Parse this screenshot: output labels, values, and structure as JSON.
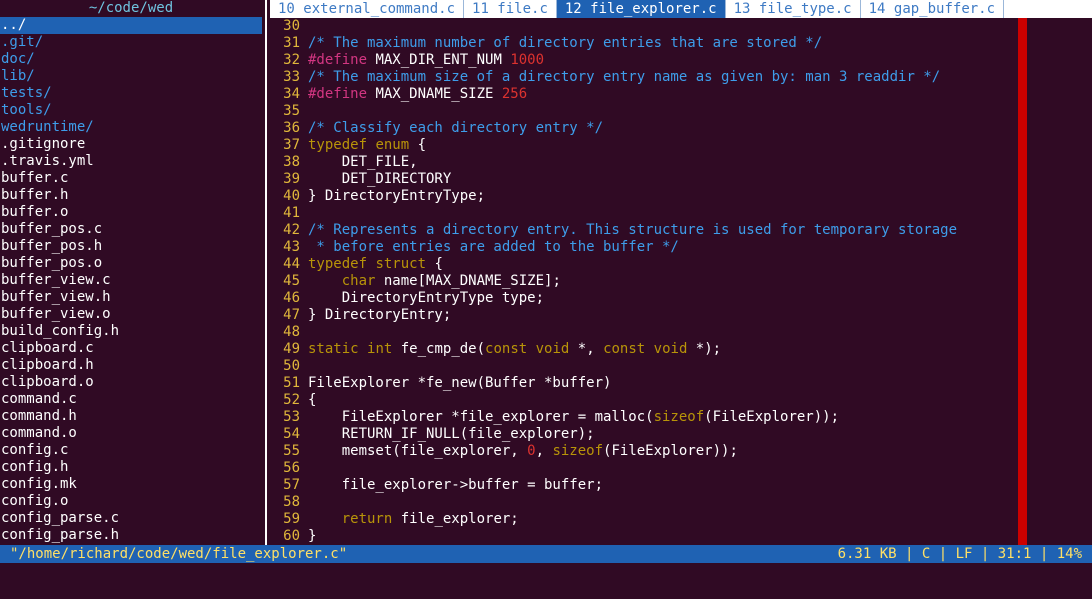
{
  "sidebar": {
    "title": "~/code/wed",
    "items": [
      {
        "label": "../",
        "kind": "dir",
        "selected": true
      },
      {
        "label": ".git/",
        "kind": "dir"
      },
      {
        "label": "doc/",
        "kind": "dir"
      },
      {
        "label": "lib/",
        "kind": "dir"
      },
      {
        "label": "tests/",
        "kind": "dir"
      },
      {
        "label": "tools/",
        "kind": "dir"
      },
      {
        "label": "wedruntime/",
        "kind": "dir"
      },
      {
        "label": ".gitignore",
        "kind": "file"
      },
      {
        "label": ".travis.yml",
        "kind": "file"
      },
      {
        "label": "buffer.c",
        "kind": "file"
      },
      {
        "label": "buffer.h",
        "kind": "file"
      },
      {
        "label": "buffer.o",
        "kind": "file"
      },
      {
        "label": "buffer_pos.c",
        "kind": "file"
      },
      {
        "label": "buffer_pos.h",
        "kind": "file"
      },
      {
        "label": "buffer_pos.o",
        "kind": "file"
      },
      {
        "label": "buffer_view.c",
        "kind": "file"
      },
      {
        "label": "buffer_view.h",
        "kind": "file"
      },
      {
        "label": "buffer_view.o",
        "kind": "file"
      },
      {
        "label": "build_config.h",
        "kind": "file"
      },
      {
        "label": "clipboard.c",
        "kind": "file"
      },
      {
        "label": "clipboard.h",
        "kind": "file"
      },
      {
        "label": "clipboard.o",
        "kind": "file"
      },
      {
        "label": "command.c",
        "kind": "file"
      },
      {
        "label": "command.h",
        "kind": "file"
      },
      {
        "label": "command.o",
        "kind": "file"
      },
      {
        "label": "config.c",
        "kind": "file"
      },
      {
        "label": "config.h",
        "kind": "file"
      },
      {
        "label": "config.mk",
        "kind": "file"
      },
      {
        "label": "config.o",
        "kind": "file"
      },
      {
        "label": "config_parse.c",
        "kind": "file"
      },
      {
        "label": "config_parse.h",
        "kind": "file"
      }
    ]
  },
  "tabs": [
    {
      "label": "10 external_command.c",
      "active": false
    },
    {
      "label": "11 file.c",
      "active": false
    },
    {
      "label": "12 file_explorer.c",
      "active": true
    },
    {
      "label": "13 file_type.c",
      "active": false
    },
    {
      "label": "14 gap_buffer.c",
      "active": false
    }
  ],
  "editor": {
    "lines": [
      {
        "num": "30",
        "segments": []
      },
      {
        "num": "31",
        "segments": [
          {
            "t": "/* The maximum number of directory entries that are stored */",
            "c": "comment"
          }
        ]
      },
      {
        "num": "32",
        "segments": [
          {
            "t": "#define",
            "c": "pre"
          },
          {
            "t": " MAX_DIR_ENT_NUM ",
            "c": "plain"
          },
          {
            "t": "1000",
            "c": "num"
          }
        ]
      },
      {
        "num": "33",
        "segments": [
          {
            "t": "/* The maximum size of a directory entry name as given by: man 3 readdir */",
            "c": "comment"
          }
        ]
      },
      {
        "num": "34",
        "segments": [
          {
            "t": "#define",
            "c": "pre"
          },
          {
            "t": " MAX_DNAME_SIZE ",
            "c": "plain"
          },
          {
            "t": "256",
            "c": "num"
          }
        ]
      },
      {
        "num": "35",
        "segments": []
      },
      {
        "num": "36",
        "segments": [
          {
            "t": "/* Classify each directory entry */",
            "c": "comment"
          }
        ]
      },
      {
        "num": "37",
        "segments": [
          {
            "t": "typedef",
            "c": "kw"
          },
          {
            "t": " ",
            "c": "plain"
          },
          {
            "t": "enum",
            "c": "kw"
          },
          {
            "t": " {",
            "c": "plain"
          }
        ]
      },
      {
        "num": "38",
        "segments": [
          {
            "t": "    DET_FILE,",
            "c": "plain"
          }
        ]
      },
      {
        "num": "39",
        "segments": [
          {
            "t": "    DET_DIRECTORY",
            "c": "plain"
          }
        ]
      },
      {
        "num": "40",
        "segments": [
          {
            "t": "} DirectoryEntryType;",
            "c": "plain"
          }
        ]
      },
      {
        "num": "41",
        "segments": []
      },
      {
        "num": "42",
        "segments": [
          {
            "t": "/* Represents a directory entry. This structure is used for temporary storage",
            "c": "comment"
          }
        ]
      },
      {
        "num": "43",
        "segments": [
          {
            "t": " * before entries are added to the buffer */",
            "c": "comment"
          }
        ]
      },
      {
        "num": "44",
        "segments": [
          {
            "t": "typedef",
            "c": "kw"
          },
          {
            "t": " ",
            "c": "plain"
          },
          {
            "t": "struct",
            "c": "kw"
          },
          {
            "t": " {",
            "c": "plain"
          }
        ]
      },
      {
        "num": "45",
        "segments": [
          {
            "t": "    ",
            "c": "plain"
          },
          {
            "t": "char",
            "c": "kw"
          },
          {
            "t": " name[MAX_DNAME_SIZE];",
            "c": "plain"
          }
        ]
      },
      {
        "num": "46",
        "segments": [
          {
            "t": "    DirectoryEntryType type;",
            "c": "plain"
          }
        ]
      },
      {
        "num": "47",
        "segments": [
          {
            "t": "} DirectoryEntry;",
            "c": "plain"
          }
        ]
      },
      {
        "num": "48",
        "segments": []
      },
      {
        "num": "49",
        "segments": [
          {
            "t": "static",
            "c": "kw"
          },
          {
            "t": " ",
            "c": "plain"
          },
          {
            "t": "int",
            "c": "kw"
          },
          {
            "t": " fe_cmp_de(",
            "c": "plain"
          },
          {
            "t": "const",
            "c": "kw"
          },
          {
            "t": " ",
            "c": "plain"
          },
          {
            "t": "void",
            "c": "kw"
          },
          {
            "t": " *, ",
            "c": "plain"
          },
          {
            "t": "const",
            "c": "kw"
          },
          {
            "t": " ",
            "c": "plain"
          },
          {
            "t": "void",
            "c": "kw"
          },
          {
            "t": " *);",
            "c": "plain"
          }
        ]
      },
      {
        "num": "50",
        "segments": []
      },
      {
        "num": "51",
        "segments": [
          {
            "t": "FileExplorer *fe_new(Buffer *buffer)",
            "c": "plain"
          }
        ]
      },
      {
        "num": "52",
        "segments": [
          {
            "t": "{",
            "c": "plain"
          }
        ]
      },
      {
        "num": "53",
        "segments": [
          {
            "t": "    FileExplorer *file_explorer = malloc(",
            "c": "plain"
          },
          {
            "t": "sizeof",
            "c": "kw"
          },
          {
            "t": "(FileExplorer));",
            "c": "plain"
          }
        ]
      },
      {
        "num": "54",
        "segments": [
          {
            "t": "    RETURN_IF_NULL(file_explorer);",
            "c": "plain"
          }
        ]
      },
      {
        "num": "55",
        "segments": [
          {
            "t": "    memset(file_explorer, ",
            "c": "plain"
          },
          {
            "t": "0",
            "c": "num"
          },
          {
            "t": ", ",
            "c": "plain"
          },
          {
            "t": "sizeof",
            "c": "kw"
          },
          {
            "t": "(FileExplorer));",
            "c": "plain"
          }
        ]
      },
      {
        "num": "56",
        "segments": []
      },
      {
        "num": "57",
        "segments": [
          {
            "t": "    file_explorer->buffer = buffer;",
            "c": "plain"
          }
        ]
      },
      {
        "num": "58",
        "segments": []
      },
      {
        "num": "59",
        "segments": [
          {
            "t": "    ",
            "c": "plain"
          },
          {
            "t": "return",
            "c": "kw"
          },
          {
            "t": " file_explorer;",
            "c": "plain"
          }
        ]
      },
      {
        "num": "60",
        "segments": [
          {
            "t": "}",
            "c": "plain"
          }
        ]
      }
    ]
  },
  "status": {
    "path": "\"/home/richard/code/wed/file_explorer.c\"",
    "right": "6.31 KB | C | LF | 31:1 | 14%"
  },
  "colors": {
    "background": "#300a24",
    "selection": "#1f62b3",
    "directory": "#3e9dea",
    "line_number": "#e0b73b",
    "comment": "#3e9dea",
    "preprocessor": "#d33682",
    "number": "#dc322f",
    "keyword": "#b89409",
    "ruler": "#cc0000",
    "status_text": "#ffe066"
  }
}
